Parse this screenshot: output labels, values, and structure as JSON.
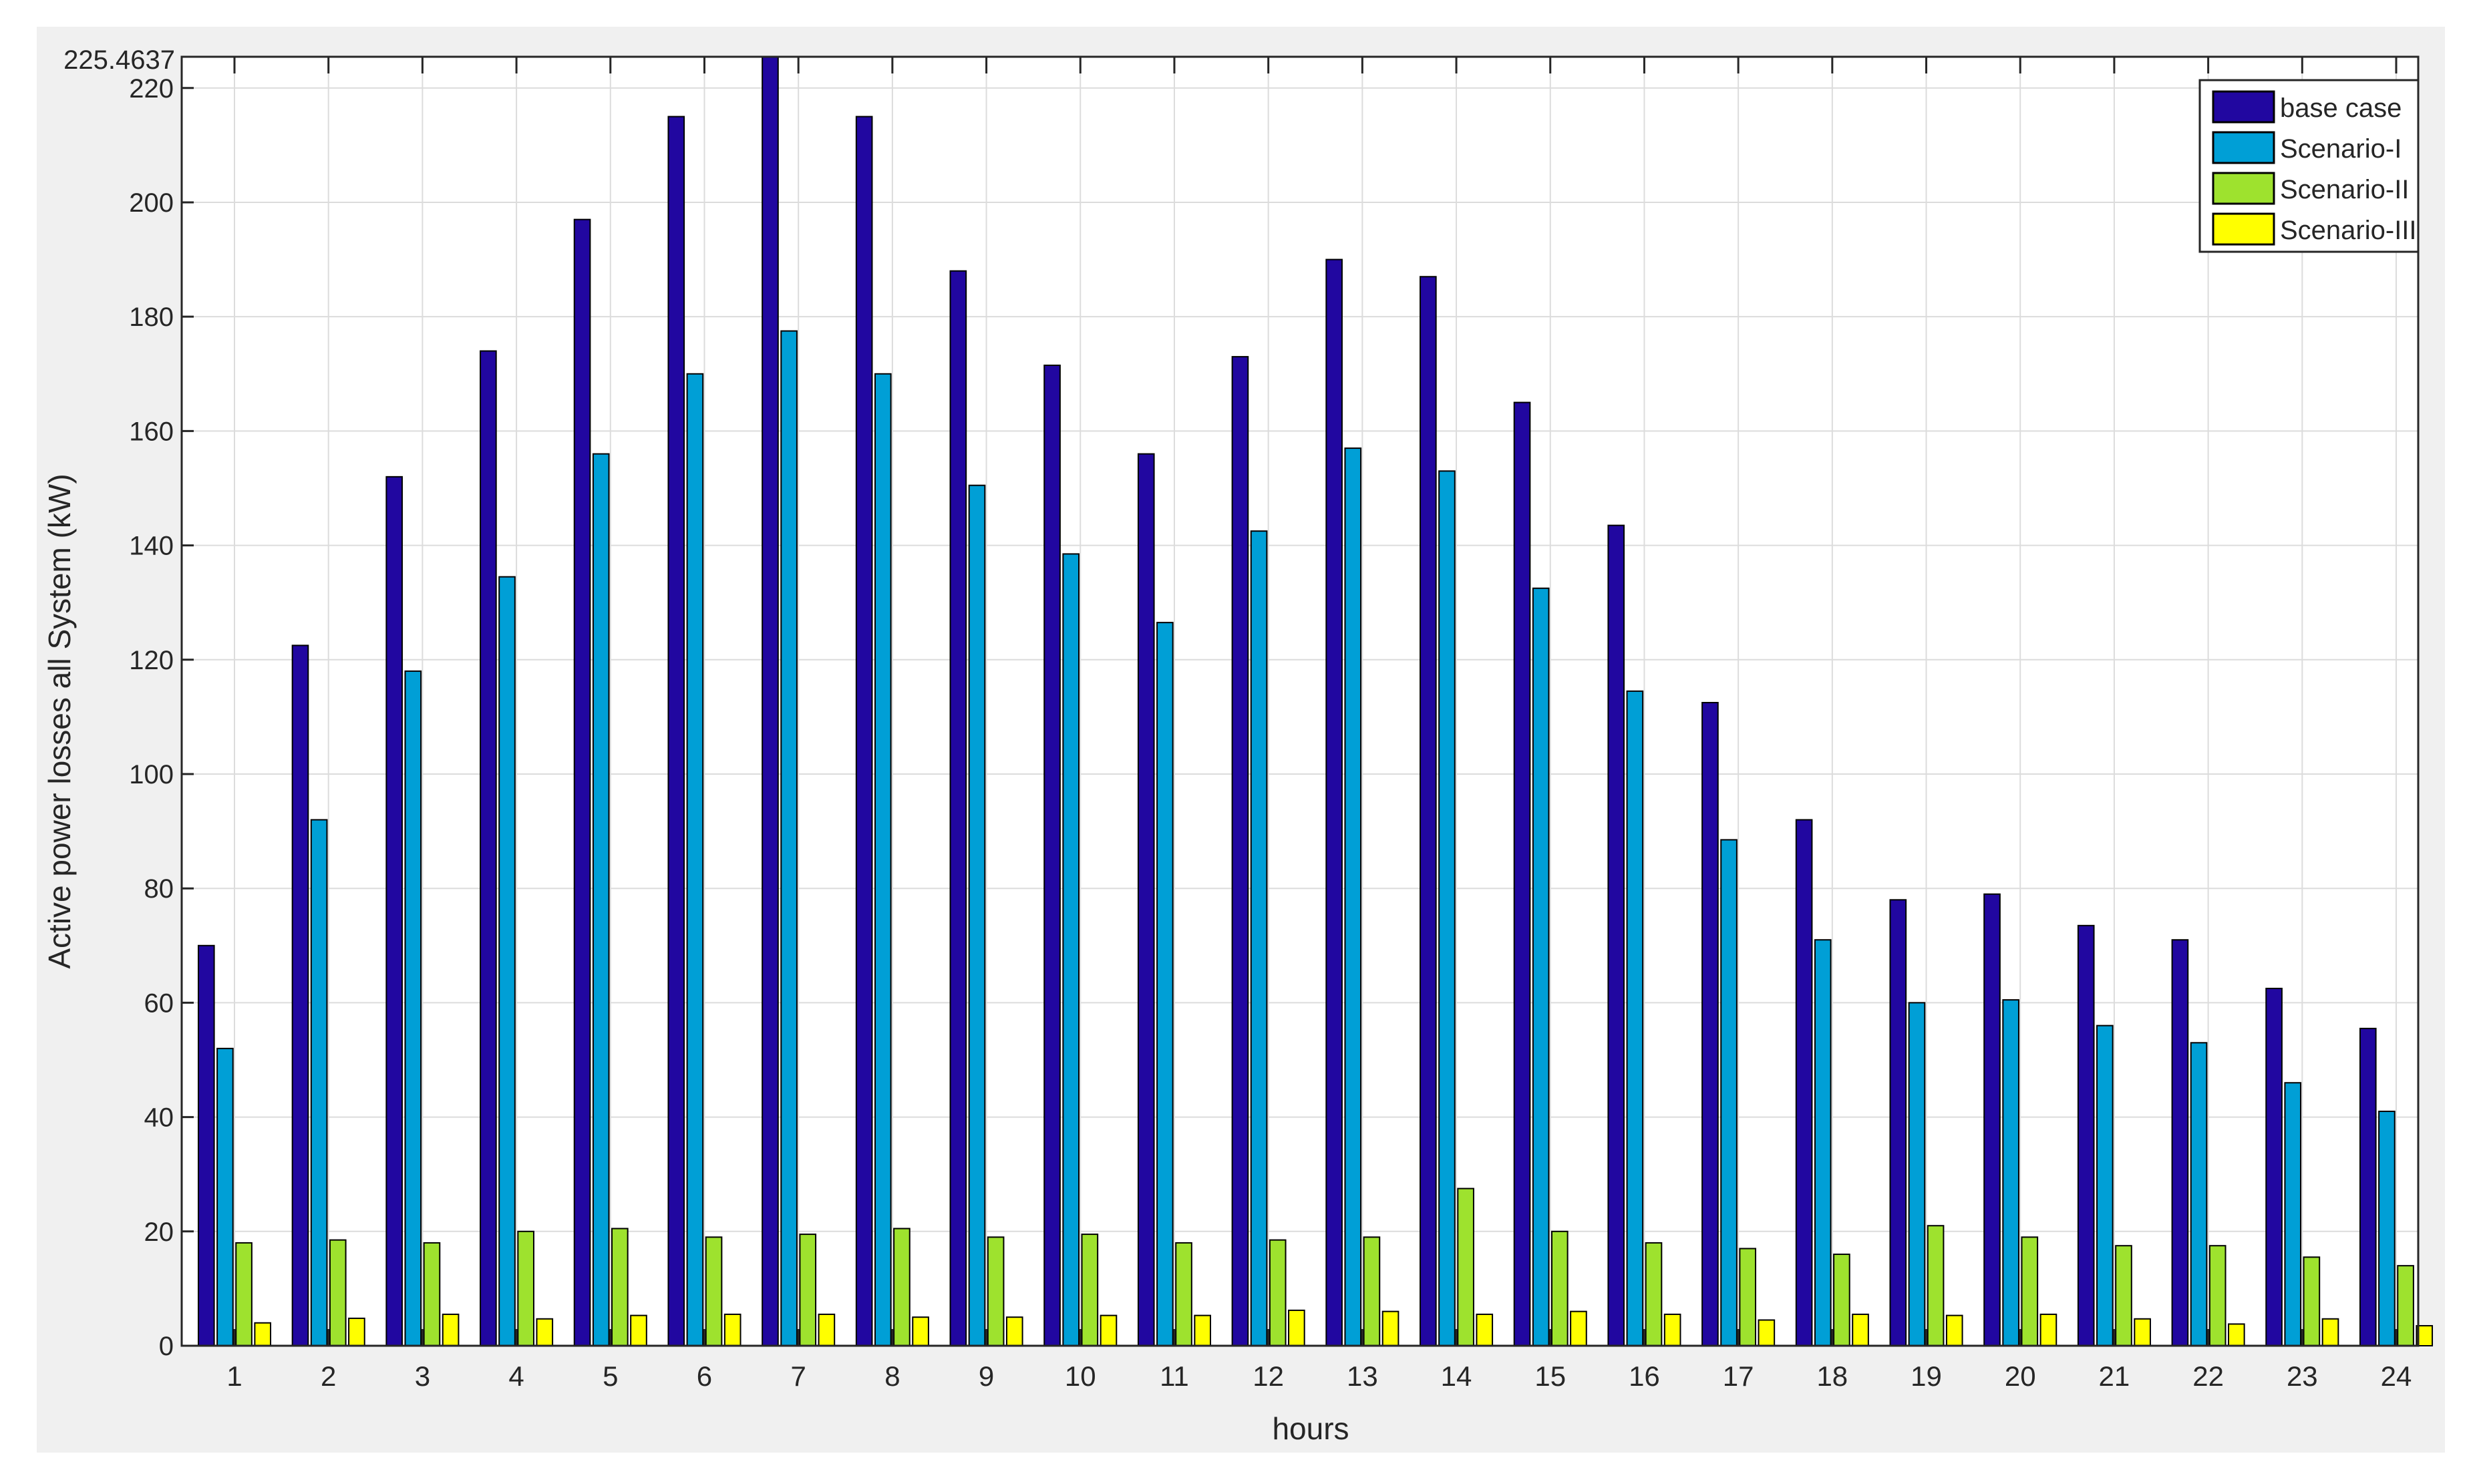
{
  "chart_data": {
    "type": "bar",
    "title": "",
    "xlabel": "hours",
    "ylabel": "Active power losses all System (kW)",
    "ylim": [
      0,
      225.4637
    ],
    "ymax_label": "225.4637",
    "yticks": [
      0,
      20,
      40,
      60,
      80,
      100,
      120,
      140,
      160,
      180,
      200,
      220
    ],
    "grid": true,
    "legend_position": "top-right",
    "categories": [
      "1",
      "2",
      "3",
      "4",
      "5",
      "6",
      "7",
      "8",
      "9",
      "10",
      "11",
      "12",
      "13",
      "14",
      "15",
      "16",
      "17",
      "18",
      "19",
      "20",
      "21",
      "22",
      "23",
      "24"
    ],
    "series": [
      {
        "name": "base case",
        "color": "#2107a0",
        "values": [
          70,
          122.5,
          152,
          174,
          197,
          215,
          225.4637,
          215,
          188,
          171.5,
          156,
          173,
          190,
          187,
          165,
          143.5,
          112.5,
          92,
          78,
          79,
          73.5,
          71,
          62.5,
          55.5
        ]
      },
      {
        "name": "Scenario-I",
        "color": "#009fd6",
        "values": [
          52,
          92,
          118,
          134.5,
          156,
          170,
          177.5,
          170,
          150.5,
          138.5,
          126.5,
          142.5,
          157,
          153,
          132.5,
          114.5,
          88.5,
          71,
          60,
          60.5,
          56,
          53,
          46,
          41
        ]
      },
      {
        "name": "Scenario-II",
        "color": "#9ee22e",
        "values": [
          18,
          18.5,
          18,
          20,
          20.5,
          19,
          19.5,
          20.5,
          19,
          19.5,
          18,
          18.5,
          19,
          27.5,
          20,
          18,
          17,
          16,
          21,
          19,
          17.5,
          17.5,
          15.5,
          14
        ]
      },
      {
        "name": "Scenario-III",
        "color": "#ffff00",
        "values": [
          4,
          4.8,
          5.5,
          4.7,
          5.3,
          5.5,
          5.5,
          5,
          5,
          5.3,
          5.3,
          6.2,
          6,
          5.5,
          6,
          5.5,
          4.5,
          5.5,
          5.3,
          5.5,
          4.7,
          3.8,
          4.7,
          3.5
        ]
      }
    ]
  }
}
